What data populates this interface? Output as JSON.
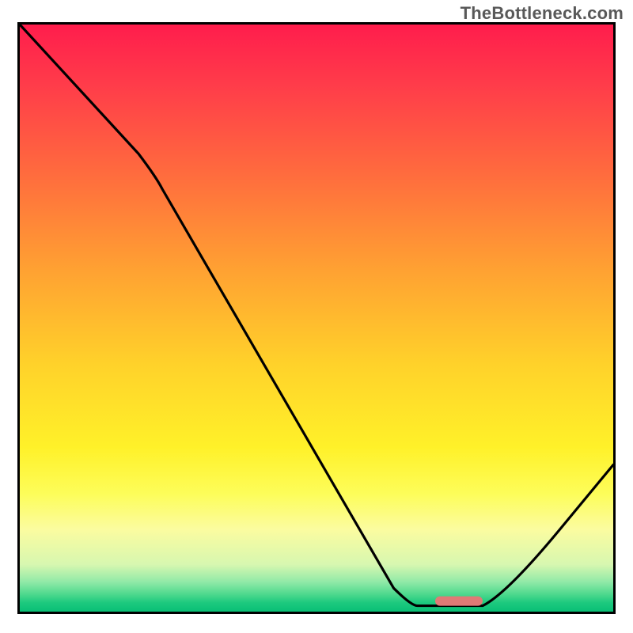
{
  "watermark": "TheBottleneck.com",
  "chart_data": {
    "type": "line",
    "title": "",
    "xlabel": "",
    "ylabel": "",
    "xlim": [
      0,
      100
    ],
    "ylim": [
      0,
      100
    ],
    "grid": false,
    "legend": false,
    "series": [
      {
        "name": "bottleneck-curve",
        "points": [
          {
            "x": 0,
            "y": 100
          },
          {
            "x": 20,
            "y": 78
          },
          {
            "x": 24,
            "y": 72
          },
          {
            "x": 63,
            "y": 4
          },
          {
            "x": 67,
            "y": 1
          },
          {
            "x": 78,
            "y": 1
          },
          {
            "x": 82,
            "y": 3
          },
          {
            "x": 100,
            "y": 25
          }
        ]
      }
    ],
    "marker": {
      "x_start": 70,
      "x_end": 78,
      "y": 1.8,
      "color": "#e07a76"
    },
    "background_gradient": {
      "top": "#ff1d4c",
      "bottom": "#0abf76"
    }
  }
}
